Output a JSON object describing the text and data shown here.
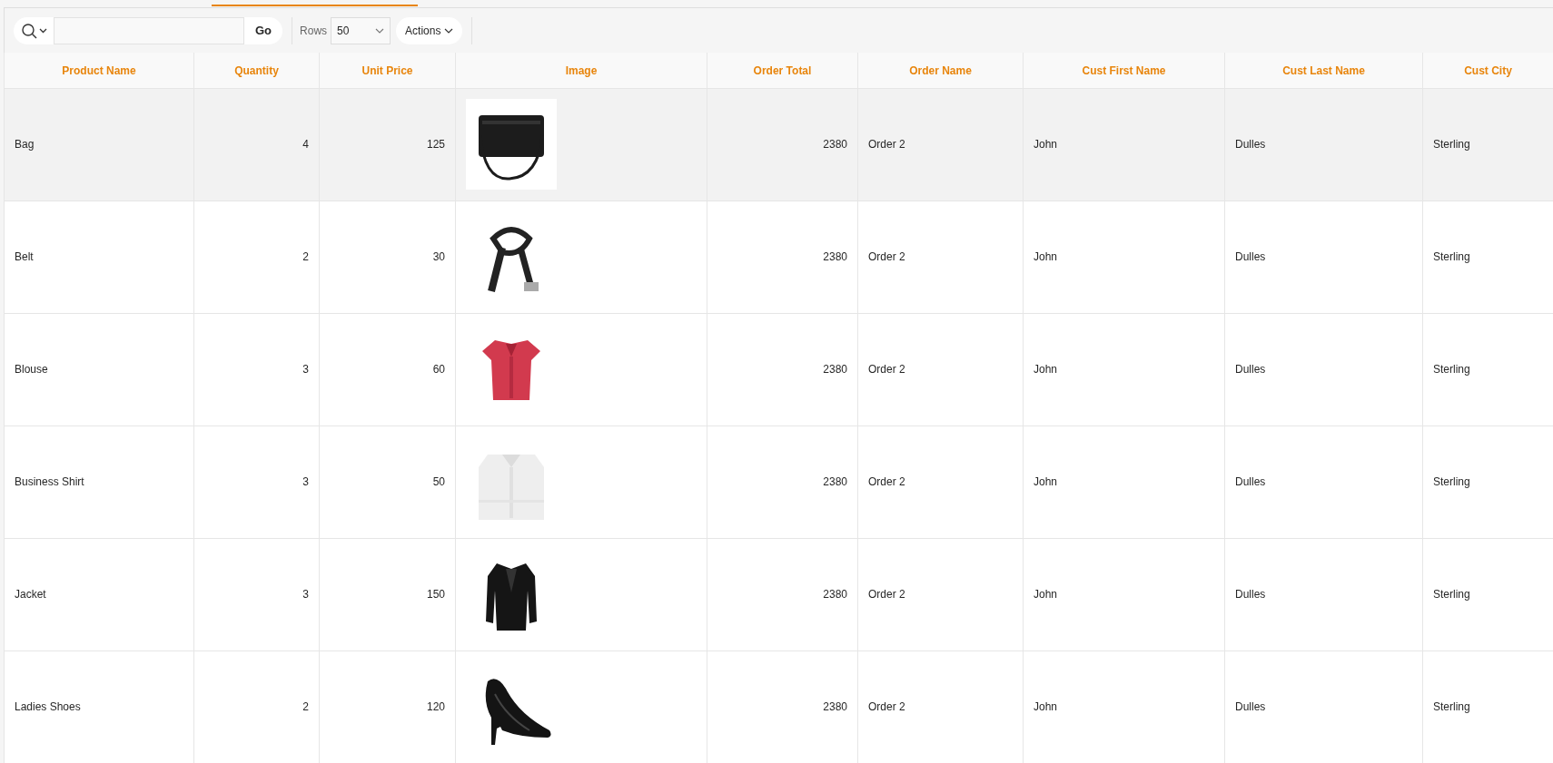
{
  "toolbar": {
    "go_button": "Go",
    "rows_label": "Rows",
    "rows_value": "50",
    "actions_button": "Actions"
  },
  "table": {
    "columns": [
      {
        "label": "Product Name",
        "kind": "text"
      },
      {
        "label": "Quantity",
        "kind": "number"
      },
      {
        "label": "Unit Price",
        "kind": "number"
      },
      {
        "label": "Image"
      },
      {
        "label": "Order Total",
        "kind": "number"
      },
      {
        "label": "Order Name",
        "kind": "text"
      },
      {
        "label": "Cust First Name",
        "kind": "text"
      },
      {
        "label": "Cust Last Name",
        "kind": "text"
      },
      {
        "label": "Cust City",
        "kind": "text"
      }
    ],
    "rows": [
      {
        "highlighted": true,
        "cells": [
          "Bag",
          "4",
          "125",
          {
            "kind": "picture"
          },
          "2380",
          "Order 2",
          "John",
          "Dulles",
          "Sterling"
        ]
      },
      {
        "highlighted": false,
        "cells": [
          "Belt",
          "2",
          "30",
          {
            "kind": "picture"
          },
          "2380",
          "Order 2",
          "John",
          "Dulles",
          "Sterling"
        ]
      },
      {
        "highlighted": false,
        "cells": [
          "Blouse",
          "3",
          "60",
          {
            "kind": "picture"
          },
          "2380",
          "Order 2",
          "John",
          "Dulles",
          "Sterling"
        ]
      },
      {
        "highlighted": false,
        "cells": [
          "Business Shirt",
          "3",
          "50",
          {
            "kind": "picture"
          },
          "2380",
          "Order 2",
          "John",
          "Dulles",
          "Sterling"
        ]
      },
      {
        "highlighted": false,
        "cells": [
          "Jacket",
          "3",
          "150",
          {
            "kind": "picture"
          },
          "2380",
          "Order 2",
          "John",
          "Dulles",
          "Sterling"
        ]
      },
      {
        "highlighted": false,
        "cells": [
          "Ladies Shoes",
          "2",
          "120",
          {
            "kind": "picture"
          },
          "2380",
          "Order 2",
          "John",
          "Dulles",
          "Sterling"
        ]
      }
    ]
  }
}
